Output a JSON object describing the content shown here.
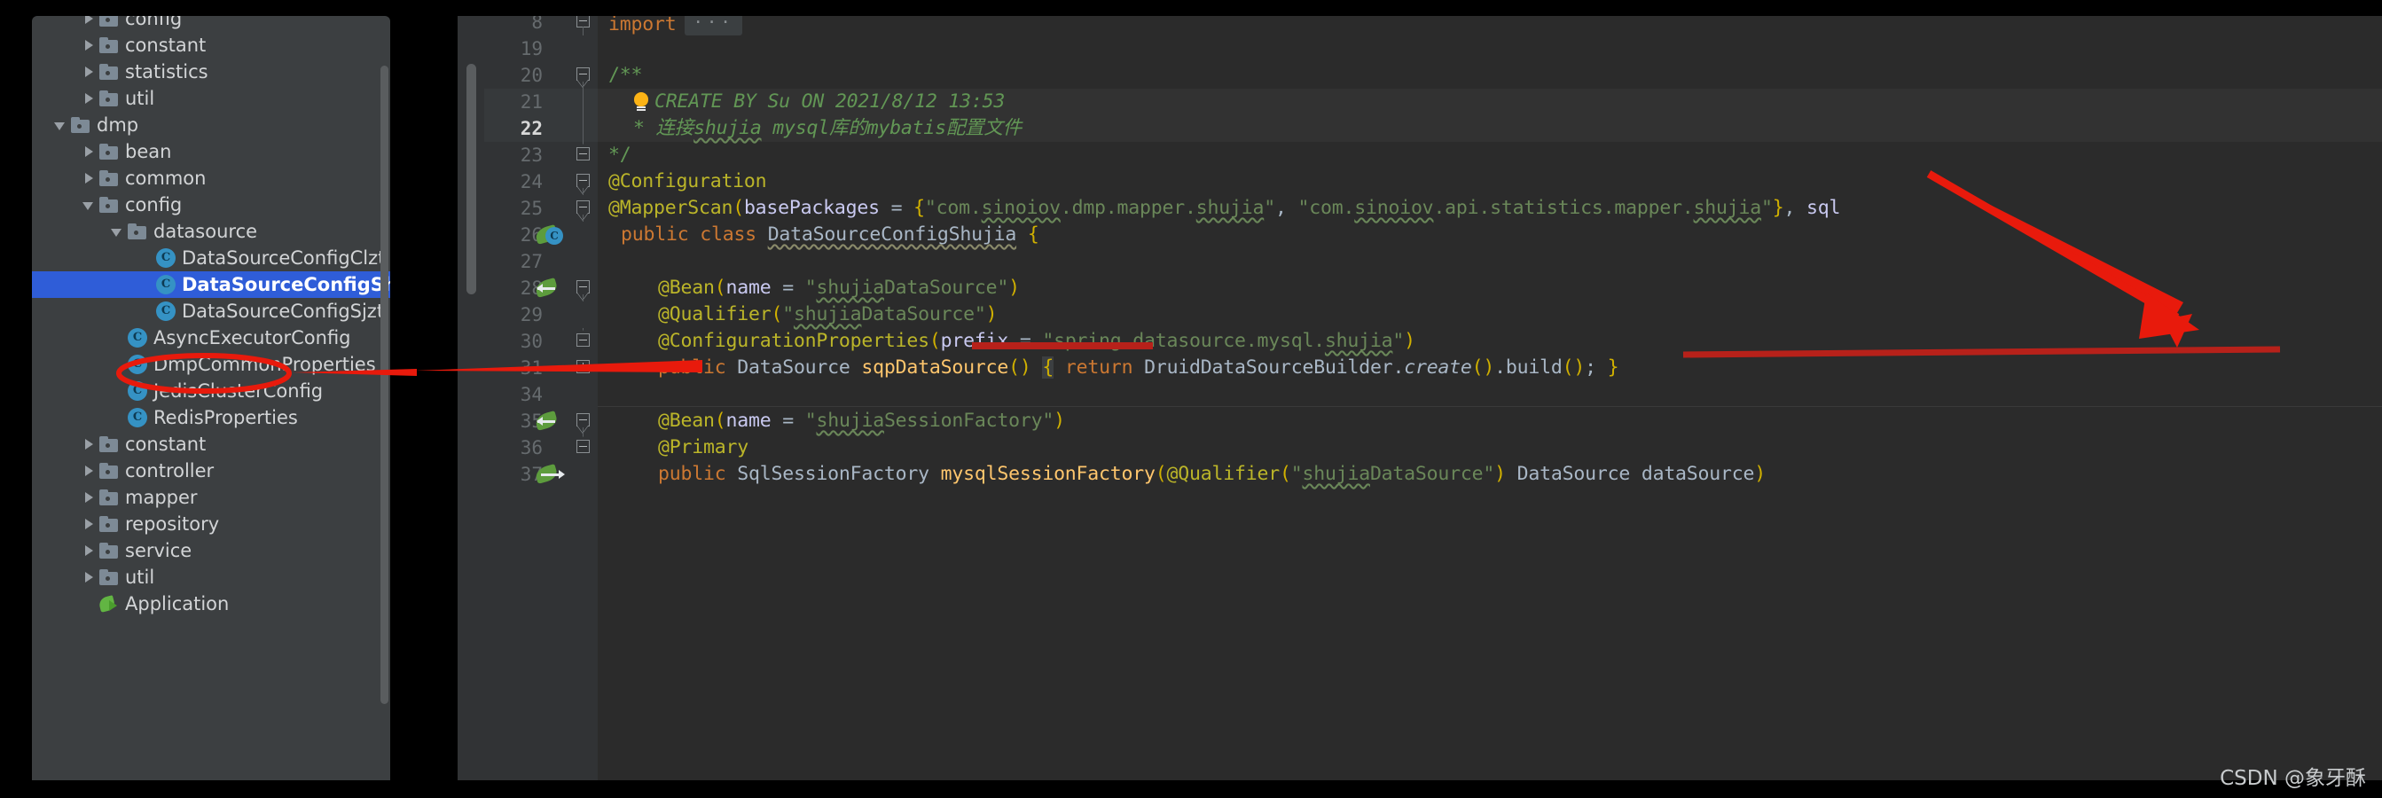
{
  "app": {
    "theme": "darcula",
    "colors": {
      "sidebar_bg": "#3c3f41",
      "editor_bg": "#2b2b2b",
      "gutter_bg": "#313335",
      "selection_blue": "#2f5dd8",
      "annotation_red": "#e81a0c",
      "comment_green": "#629755",
      "string_green": "#6a8759",
      "keyword_orange": "#cc7832",
      "annotation_yellow": "#bbb529",
      "method_yellow": "#ffc66d",
      "field_purple": "#9876aa",
      "identifier_grey": "#a9b7c6"
    }
  },
  "sidebar": {
    "name": "project-tree",
    "scrollbar": true,
    "items": [
      {
        "label": "config",
        "indent": 1,
        "icon": "folder",
        "arrow": "closed",
        "selected": false,
        "clipped": true
      },
      {
        "label": "constant",
        "indent": 1,
        "icon": "folder",
        "arrow": "closed",
        "selected": false
      },
      {
        "label": "statistics",
        "indent": 1,
        "icon": "folder",
        "arrow": "closed",
        "selected": false
      },
      {
        "label": "util",
        "indent": 1,
        "icon": "folder",
        "arrow": "closed",
        "selected": false
      },
      {
        "label": "dmp",
        "indent": 0,
        "icon": "folder",
        "arrow": "open",
        "selected": false
      },
      {
        "label": "bean",
        "indent": 1,
        "icon": "folder",
        "arrow": "closed",
        "selected": false
      },
      {
        "label": "common",
        "indent": 1,
        "icon": "folder",
        "arrow": "closed",
        "selected": false
      },
      {
        "label": "config",
        "indent": 1,
        "icon": "folder",
        "arrow": "open",
        "selected": false
      },
      {
        "label": "datasource",
        "indent": 2,
        "icon": "folder",
        "arrow": "open",
        "selected": false
      },
      {
        "label": "DataSourceConfigClzt",
        "indent": 3,
        "icon": "class",
        "arrow": "none",
        "selected": false
      },
      {
        "label": "DataSourceConfigShujia",
        "indent": 3,
        "icon": "class",
        "arrow": "none",
        "selected": true
      },
      {
        "label": "DataSourceConfigSjzt",
        "indent": 3,
        "icon": "class",
        "arrow": "none",
        "selected": false
      },
      {
        "label": "AsyncExecutorConfig",
        "indent": 2,
        "icon": "class",
        "arrow": "none",
        "selected": false
      },
      {
        "label": "DmpCommonProperties",
        "indent": 2,
        "icon": "class",
        "arrow": "none",
        "selected": false
      },
      {
        "label": "JedisClusterConfig",
        "indent": 2,
        "icon": "class",
        "arrow": "none",
        "selected": false
      },
      {
        "label": "RedisProperties",
        "indent": 2,
        "icon": "class",
        "arrow": "none",
        "selected": false
      },
      {
        "label": "constant",
        "indent": 1,
        "icon": "folder",
        "arrow": "closed",
        "selected": false
      },
      {
        "label": "controller",
        "indent": 1,
        "icon": "folder",
        "arrow": "closed",
        "selected": false
      },
      {
        "label": "mapper",
        "indent": 1,
        "icon": "folder",
        "arrow": "closed",
        "selected": false
      },
      {
        "label": "repository",
        "indent": 1,
        "icon": "folder",
        "arrow": "closed",
        "selected": false
      },
      {
        "label": "service",
        "indent": 1,
        "icon": "folder",
        "arrow": "closed",
        "selected": false
      },
      {
        "label": "util",
        "indent": 1,
        "icon": "folder",
        "arrow": "closed",
        "selected": false
      },
      {
        "label": "Application",
        "indent": 1,
        "icon": "springboot",
        "arrow": "none",
        "selected": false,
        "clipped": true
      }
    ]
  },
  "editor": {
    "name": "code-editor",
    "file": "DataSourceConfigShujia",
    "current_line": 22,
    "line_numbers": [
      "8",
      "19",
      "20",
      "21",
      "22",
      "23",
      "24",
      "25",
      "26",
      "27",
      "28",
      "29",
      "30",
      "31",
      "34",
      "35",
      "36",
      "37"
    ],
    "lines": [
      {
        "num": "8",
        "text": "import ...",
        "gutter_icon": "",
        "fold": "collapsed-import"
      },
      {
        "num": "19",
        "text": "",
        "gutter_icon": "",
        "fold": ""
      },
      {
        "num": "20",
        "text": "/**",
        "gutter_icon": "",
        "fold": "open-top"
      },
      {
        "num": "21",
        "text": "CREATE BY Su ON 2021/8/12 13:53",
        "gutter_icon": "",
        "fold": "line",
        "has_bulb": true
      },
      {
        "num": "22",
        "text": "* 连接shujia mysql库的mybatis配置文件",
        "gutter_icon": "",
        "fold": "line",
        "current": true
      },
      {
        "num": "23",
        "text": "*/",
        "gutter_icon": "",
        "fold": "open-bottom"
      },
      {
        "num": "24",
        "text": "@Configuration",
        "gutter_icon": "",
        "fold": "open-top"
      },
      {
        "num": "25",
        "text": "@MapperScan(basePackages = {\"com.sinoiov.dmp.mapper.shujia\", \"com.sinoiov.api.statistics.mapper.shujia\"}, sql",
        "gutter_icon": "",
        "fold": "open-top"
      },
      {
        "num": "26",
        "text": "public class DataSourceConfigShujia {",
        "gutter_icon": "spring-bean-class",
        "fold": ""
      },
      {
        "num": "27",
        "text": "",
        "gutter_icon": "",
        "fold": ""
      },
      {
        "num": "28",
        "text": "@Bean(name = \"shujiaDataSource\")",
        "gutter_icon": "spring-bean-arrow-left",
        "fold": "open-top"
      },
      {
        "num": "29",
        "text": "@Qualifier(\"shujiaDataSource\")",
        "gutter_icon": "",
        "fold": ""
      },
      {
        "num": "30",
        "text": "@ConfigurationProperties(prefix = \"spring.datasource.mysql.shujia\")",
        "gutter_icon": "",
        "fold": "open-bottom"
      },
      {
        "num": "31",
        "text": "public DataSource sqpDataSource() { return DruidDataSourceBuilder.create().build(); }",
        "gutter_icon": "",
        "fold": "collapsed"
      },
      {
        "num": "34",
        "text": "",
        "gutter_icon": "",
        "fold": ""
      },
      {
        "num": "35",
        "text": "@Bean(name = \"shujiaSessionFactory\")",
        "gutter_icon": "spring-bean-arrow-left",
        "fold": "open-top"
      },
      {
        "num": "36",
        "text": "@Primary",
        "gutter_icon": "",
        "fold": "open-bottom"
      },
      {
        "num": "37",
        "text": "public SqlSessionFactory mysqlSessionFactory(@Qualifier(\"shujiaDataSource\") DataSource dataSource)",
        "gutter_icon": "spring-bean-arrow-right",
        "fold": ""
      }
    ],
    "import_fold_label": "..."
  },
  "annotations": {
    "name": "red-markup",
    "ellipse_target": "DataSourceConfigShujia",
    "arrow_to_tree": true,
    "arrow_to_mapperscan": true,
    "underline_basePackages": true,
    "underline_second_package": true
  },
  "watermark": {
    "text": "CSDN @象牙酥"
  }
}
